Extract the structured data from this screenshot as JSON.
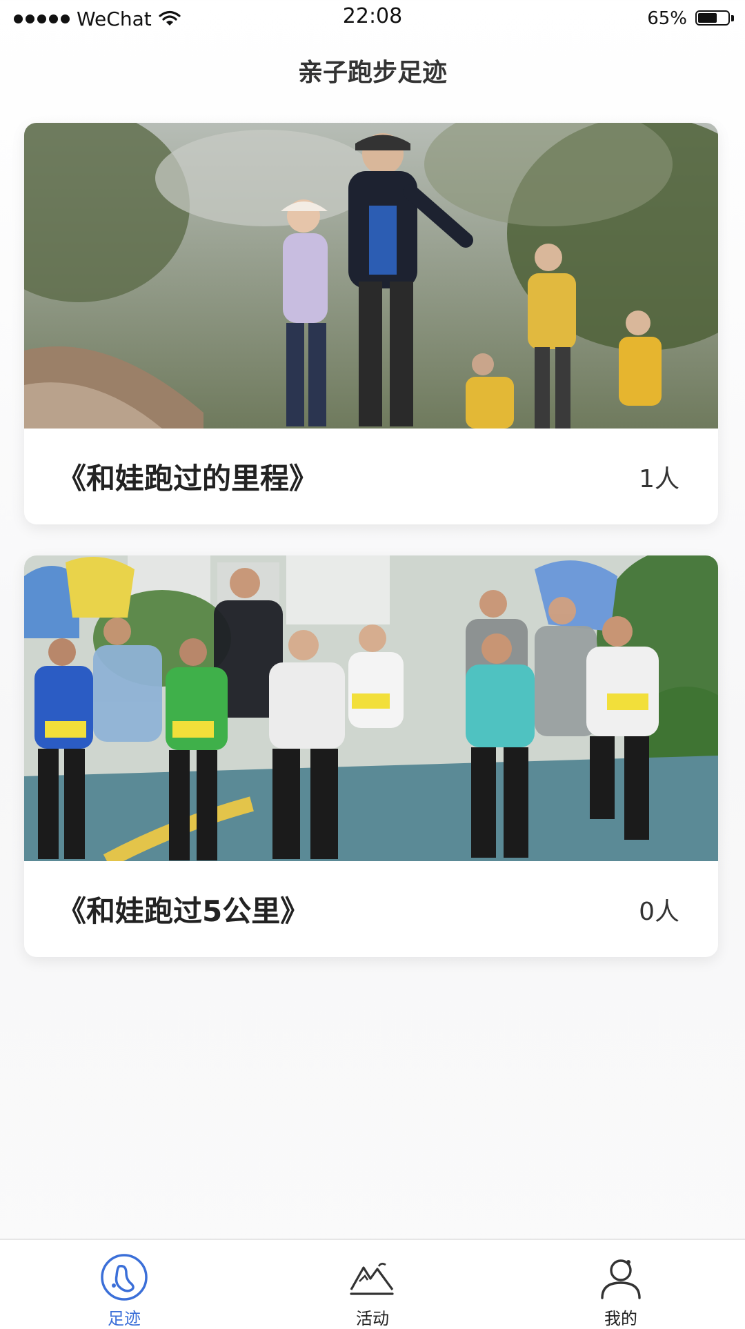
{
  "status_bar": {
    "carrier": "WeChat",
    "time": "22:08",
    "battery": "65%",
    "battery_level": 0.65
  },
  "header": {
    "title": "亲子跑步足迹"
  },
  "cards": [
    {
      "title": "《和娃跑过的里程》",
      "count": "1人"
    },
    {
      "title": "《和娃跑过5公里》",
      "count": "0人"
    }
  ],
  "tab_bar": {
    "items": [
      {
        "label": "足迹",
        "icon": "footprint-icon",
        "active": true
      },
      {
        "label": "活动",
        "icon": "mountain-icon",
        "active": false
      },
      {
        "label": "我的",
        "icon": "user-icon",
        "active": false
      }
    ]
  },
  "colors": {
    "accent": "#3b6fd8",
    "text": "#222222"
  }
}
